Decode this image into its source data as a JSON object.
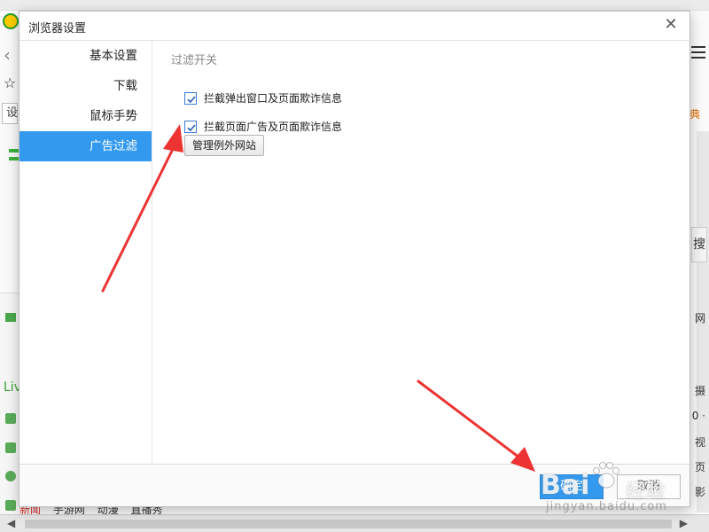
{
  "dialog": {
    "title": "浏览器设置",
    "close_glyph": "✕"
  },
  "sidebar": {
    "items": [
      {
        "label": "基本设置",
        "active": false
      },
      {
        "label": "下载",
        "active": false
      },
      {
        "label": "鼠标手势",
        "active": false
      },
      {
        "label": "广告过滤",
        "active": true
      }
    ]
  },
  "content": {
    "section_title": "过滤开关",
    "checkboxes": [
      {
        "label": "拦截弹出窗口及页面欺诈信息",
        "checked": true
      },
      {
        "label": "拦截页面广告及页面欺诈信息",
        "checked": true
      }
    ],
    "manage_button": "管理例外网站"
  },
  "footer": {
    "ok_button": "确定",
    "cancel_button": "取消"
  },
  "background": {
    "addr_char": "设",
    "orange_char": "典",
    "search_char": "搜",
    "live_text": "Liv",
    "right_texts": [
      "网",
      "摄",
      "0 ·",
      "视",
      "页",
      "影"
    ],
    "bottom_links": [
      "新闻",
      "手游网",
      "动漫",
      "直播秀"
    ]
  },
  "watermark": {
    "brand": "Bai",
    "brand2": "经验",
    "url": "jingyan.baidu.com"
  },
  "colors": {
    "accent": "#3399ee",
    "annotation_arrow": "#ee3333"
  }
}
